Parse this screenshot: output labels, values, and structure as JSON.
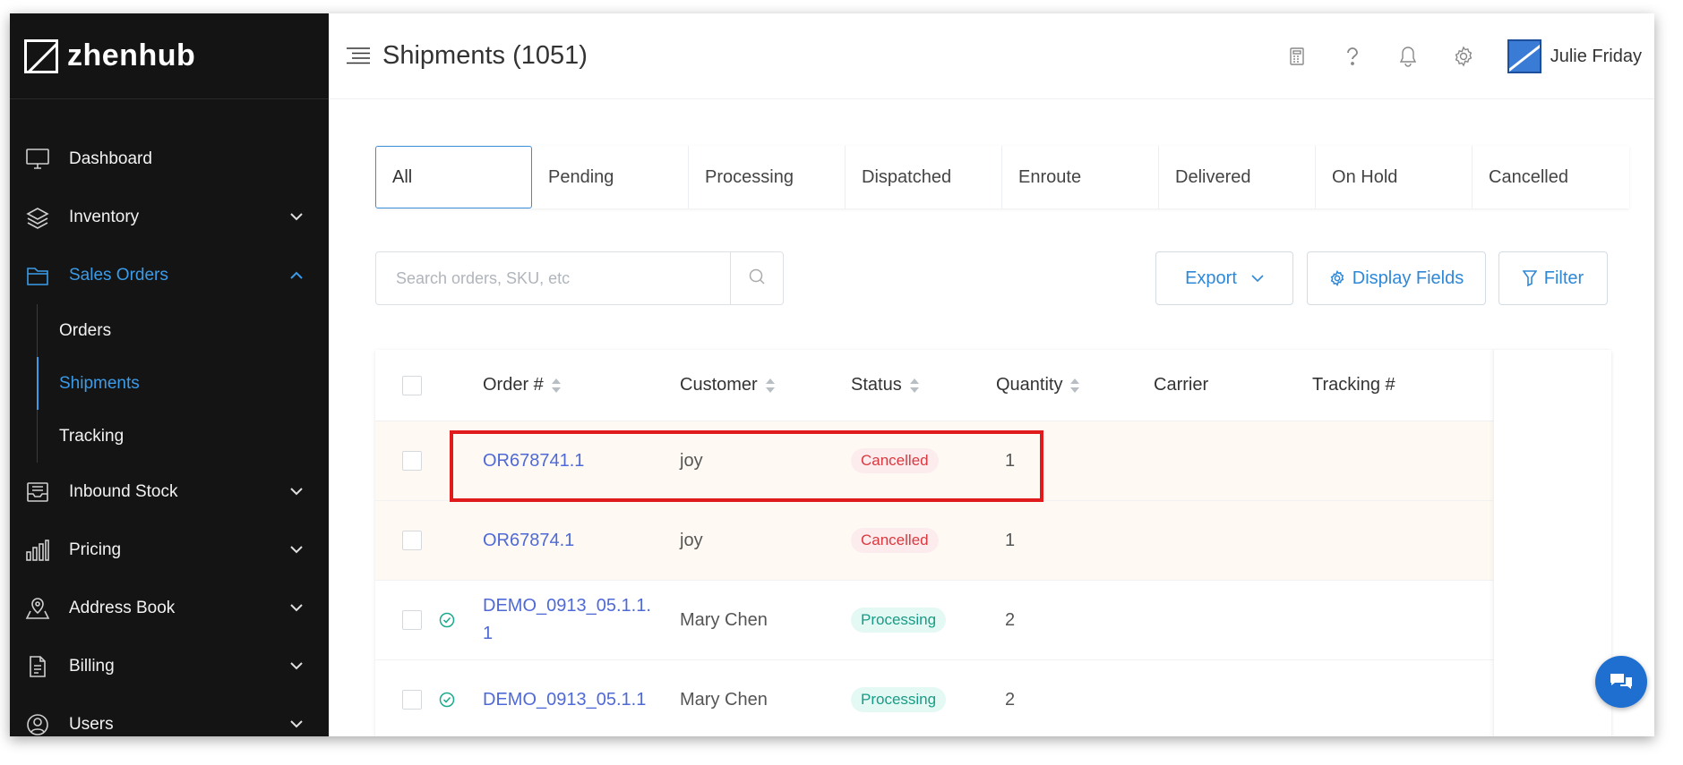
{
  "app": {
    "brand": "zhenhub",
    "page_title": "Shipments (1051)"
  },
  "user": {
    "name": "Julie Friday"
  },
  "sidebar": {
    "items": [
      {
        "label": "Dashboard",
        "icon": "monitor-icon"
      },
      {
        "label": "Inventory",
        "icon": "layers-icon"
      },
      {
        "label": "Sales Orders",
        "icon": "folder-icon"
      },
      {
        "label": "Inbound Stock",
        "icon": "inbox-icon"
      },
      {
        "label": "Pricing",
        "icon": "bar-chart-icon"
      },
      {
        "label": "Address Book",
        "icon": "map-pin-icon"
      },
      {
        "label": "Billing",
        "icon": "document-icon"
      },
      {
        "label": "Users",
        "icon": "users-icon"
      }
    ],
    "sales_sub": [
      "Orders",
      "Shipments",
      "Tracking"
    ]
  },
  "tabs": [
    "All",
    "Pending",
    "Processing",
    "Dispatched",
    "Enroute",
    "Delivered",
    "On Hold",
    "Cancelled"
  ],
  "toolbar": {
    "search_placeholder": "Search orders, SKU, etc",
    "export_label": "Export",
    "display_fields_label": "Display Fields",
    "filter_label": "Filter"
  },
  "table": {
    "headers": [
      "Order #",
      "Customer",
      "Status",
      "Quantity",
      "Carrier",
      "Tracking #"
    ],
    "rows": [
      {
        "order": "OR678741.1",
        "customer": "joy",
        "status": "Cancelled",
        "quantity": "1"
      },
      {
        "order": "OR67874.1",
        "customer": "joy",
        "status": "Cancelled",
        "quantity": "1"
      },
      {
        "order_line1": "DEMO_0913_05.1.1.",
        "order_line2": "1",
        "customer": "Mary Chen",
        "status": "Processing",
        "quantity": "2"
      },
      {
        "order": "DEMO_0913_05.1.1",
        "customer": "Mary Chen",
        "status": "Processing",
        "quantity": "2"
      }
    ]
  },
  "colors": {
    "accent": "#3b9be8",
    "sidebar_bg": "#141414",
    "highlight": "#e01b1b",
    "link": "#4f69d6"
  }
}
